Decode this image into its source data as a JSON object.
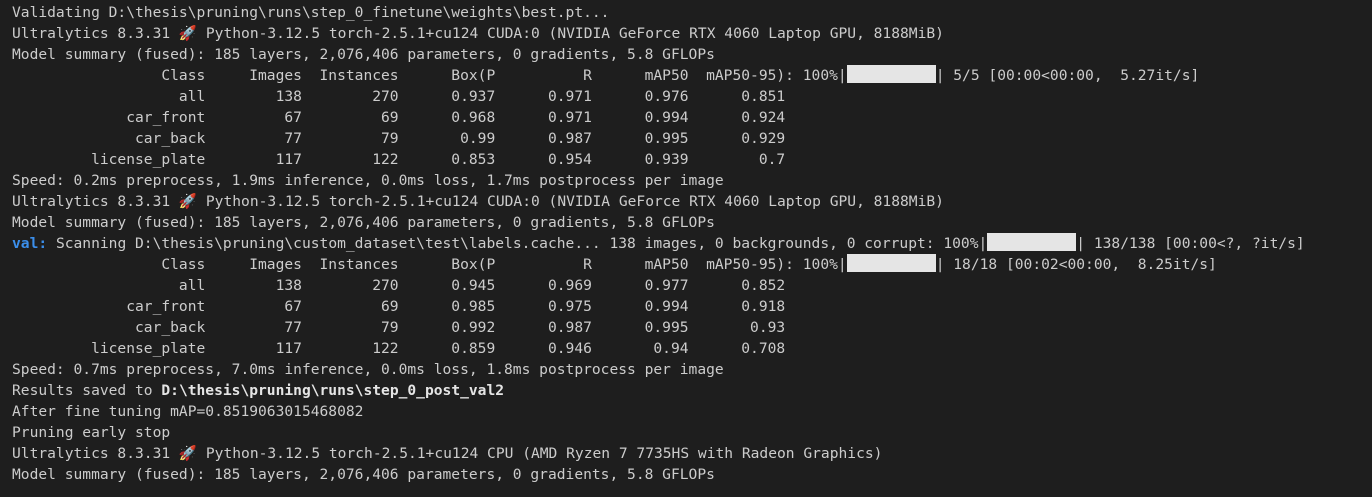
{
  "terminal": {
    "validating": "Validating D:\\thesis\\pruning\\runs\\step_0_finetune\\weights\\best.pt...",
    "env_gpu": "Ultralytics 8.3.31 🚀 Python-3.12.5 torch-2.5.1+cu124 CUDA:0 (NVIDIA GeForce RTX 4060 Laptop GPU, 8188MiB)",
    "env_cpu": "Ultralytics 8.3.31 🚀 Python-3.12.5 torch-2.5.1+cu124 CPU (AMD Ryzen 7 7735HS with Radeon Graphics)",
    "model_summary": "Model summary (fused): 185 layers, 2,076,406 parameters, 0 gradients, 5.8 GFLOPs",
    "header_text": "                 Class     Images  Instances      Box(P          R      mAP50  mAP50-95): 100%|",
    "run1": {
      "progress_percent": 100,
      "progress_tail": "| 5/5 [00:00<00:00,  5.27it/s]",
      "rows": [
        "                   all        138        270      0.937      0.971      0.976      0.851",
        "             car_front         67         69      0.968      0.971      0.994      0.924",
        "              car_back         77         79       0.99      0.987      0.995      0.929",
        "         license_plate        117        122      0.853      0.954      0.939        0.7"
      ],
      "speed": "Speed: 0.2ms preprocess, 1.9ms inference, 0.0ms loss, 1.7ms postprocess per image"
    },
    "scan": {
      "prefix": "val:",
      "text": " Scanning D:\\thesis\\pruning\\custom_dataset\\test\\labels.cache... 138 images, 0 backgrounds, 0 corrupt: 100%|",
      "progress_percent": 100,
      "tail": "| 138/138 [00:00<?, ?it/s]"
    },
    "run2": {
      "progress_percent": 100,
      "progress_tail": "| 18/18 [00:02<00:00,  8.25it/s]",
      "rows": [
        "                   all        138        270      0.945      0.969      0.977      0.852",
        "             car_front         67         69      0.985      0.975      0.994      0.918",
        "              car_back         77         79      0.992      0.987      0.995       0.93",
        "         license_plate        117        122      0.859      0.946       0.94      0.708"
      ],
      "speed": "Speed: 0.7ms preprocess, 7.0ms inference, 0.0ms loss, 1.8ms postprocess per image"
    },
    "results_saved_label": "Results saved to ",
    "results_saved_path": "D:\\thesis\\pruning\\runs\\step_0_post_val2",
    "after_fine_tuning": "After fine tuning mAP=0.8519063015468082",
    "pruning_early_stop": "Pruning early stop"
  }
}
